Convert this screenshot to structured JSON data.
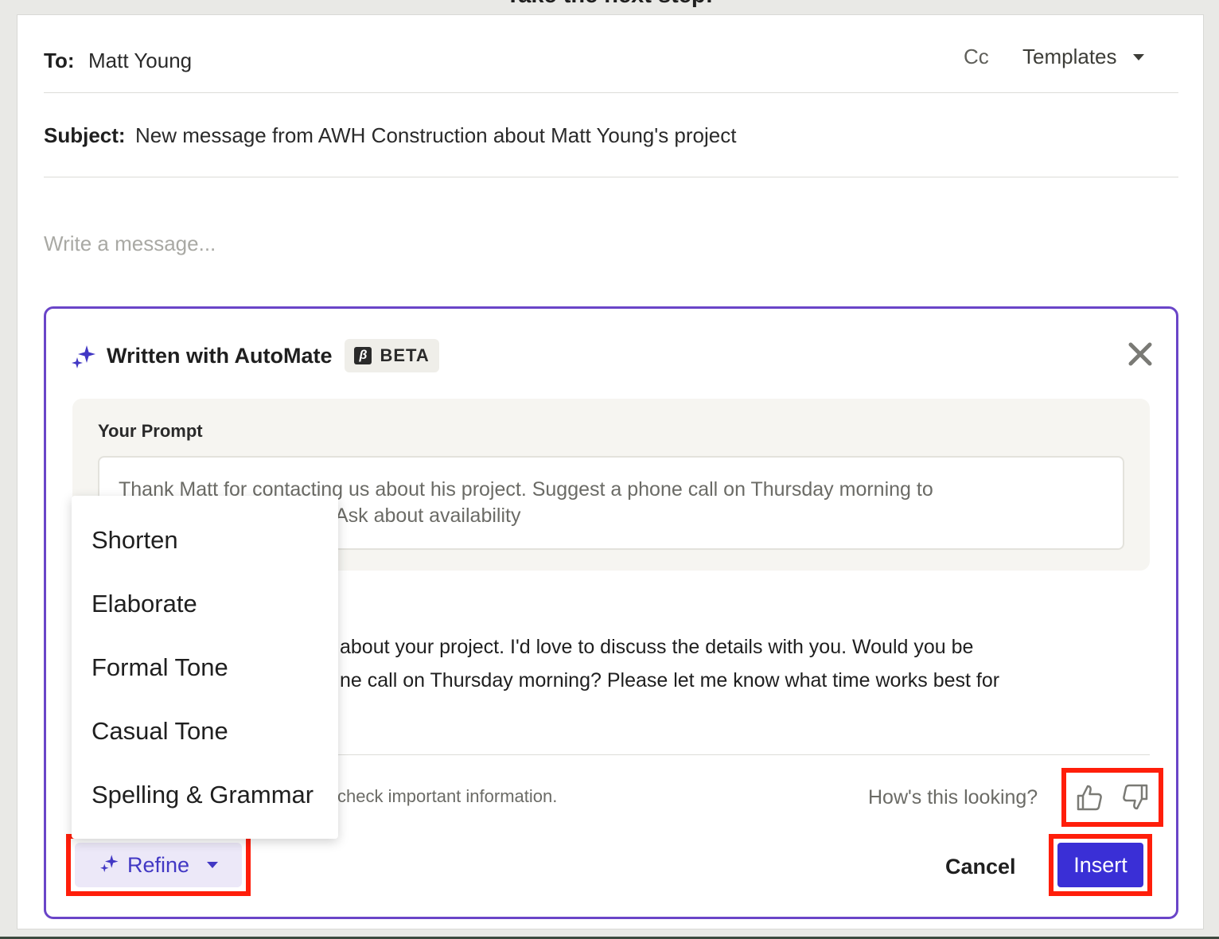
{
  "page": {
    "heading": "Take the next step!"
  },
  "email": {
    "to_label": "To:",
    "to_value": "Matt Young",
    "cc_label": "Cc",
    "templates_label": "Templates",
    "subject_label": "Subject:",
    "subject_value": "New message from AWH Construction about Matt Young's project",
    "message_placeholder": "Write a message..."
  },
  "assistant": {
    "title": "Written with AutoMate",
    "badge_glyph": "β",
    "badge": "BETA",
    "prompt_label": "Your Prompt",
    "prompt_line1": "Thank Matt for contacting us about his project. Suggest a phone call on Thursday morning to",
    "prompt_line2_visible": "Ask about availability",
    "draft_line1_visible": "about your project. I'd love to discuss the details with you. Would you be",
    "draft_line2_visible": "ne call on Thursday morning? Please let me know what time works best for",
    "disclaimer_visible": "check important information.",
    "feedback_label": "How's this looking?",
    "refine_label": "Refine",
    "cancel_label": "Cancel",
    "insert_label": "Insert",
    "refine_menu": {
      "items": [
        "Shorten",
        "Elaborate",
        "Formal Tone",
        "Casual Tone",
        "Spelling & Grammar"
      ]
    }
  },
  "colors": {
    "accent_purple": "#6a45c8",
    "insert_blue": "#3a2fd6",
    "highlight_red": "#ff1e0a",
    "refine_text": "#4238c4"
  },
  "icons": [
    "sparkle-icon",
    "beta-icon",
    "close-icon",
    "thumbs-up-icon",
    "thumbs-down-icon",
    "chevron-down-icon"
  ]
}
